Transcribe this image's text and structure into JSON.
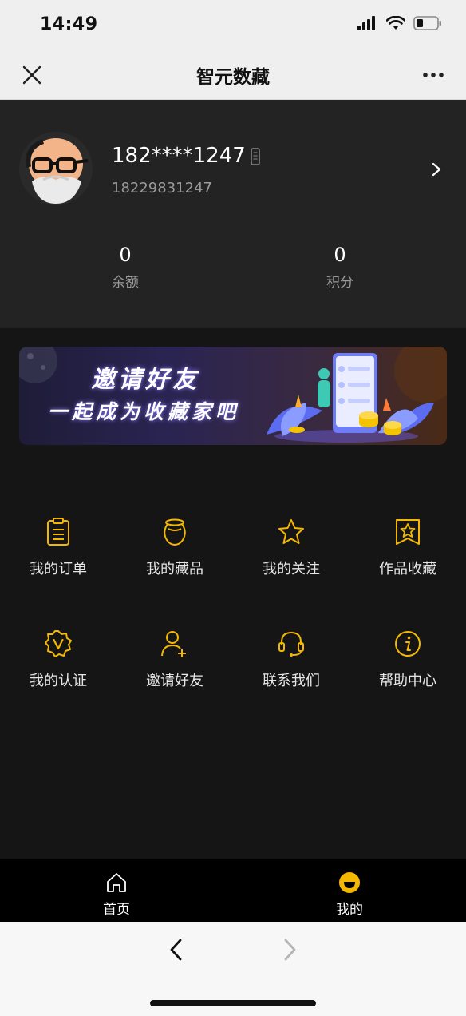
{
  "status": {
    "time": "14:49"
  },
  "nav": {
    "title": "智元数藏"
  },
  "profile": {
    "username": "182****1247",
    "phone": "18229831247",
    "stats": [
      {
        "value": "0",
        "label": "余额"
      },
      {
        "value": "0",
        "label": "积分"
      }
    ]
  },
  "banner": {
    "line1": "邀请好友",
    "line2": "一起成为收藏家吧"
  },
  "menu": [
    {
      "label": "我的订单",
      "icon": "clipboard-list-icon"
    },
    {
      "label": "我的藏品",
      "icon": "pot-icon"
    },
    {
      "label": "我的关注",
      "icon": "star-icon"
    },
    {
      "label": "作品收藏",
      "icon": "bookmark-star-icon"
    },
    {
      "label": "我的认证",
      "icon": "verified-badge-icon"
    },
    {
      "label": "邀请好友",
      "icon": "add-user-icon"
    },
    {
      "label": "联系我们",
      "icon": "headset-icon"
    },
    {
      "label": "帮助中心",
      "icon": "info-circle-icon"
    }
  ],
  "tabs": [
    {
      "label": "首页",
      "icon": "home-icon",
      "active": false
    },
    {
      "label": "我的",
      "icon": "smile-icon",
      "active": true
    }
  ],
  "colors": {
    "accent": "#f5b800",
    "background": "#151515",
    "panel": "#232323"
  }
}
